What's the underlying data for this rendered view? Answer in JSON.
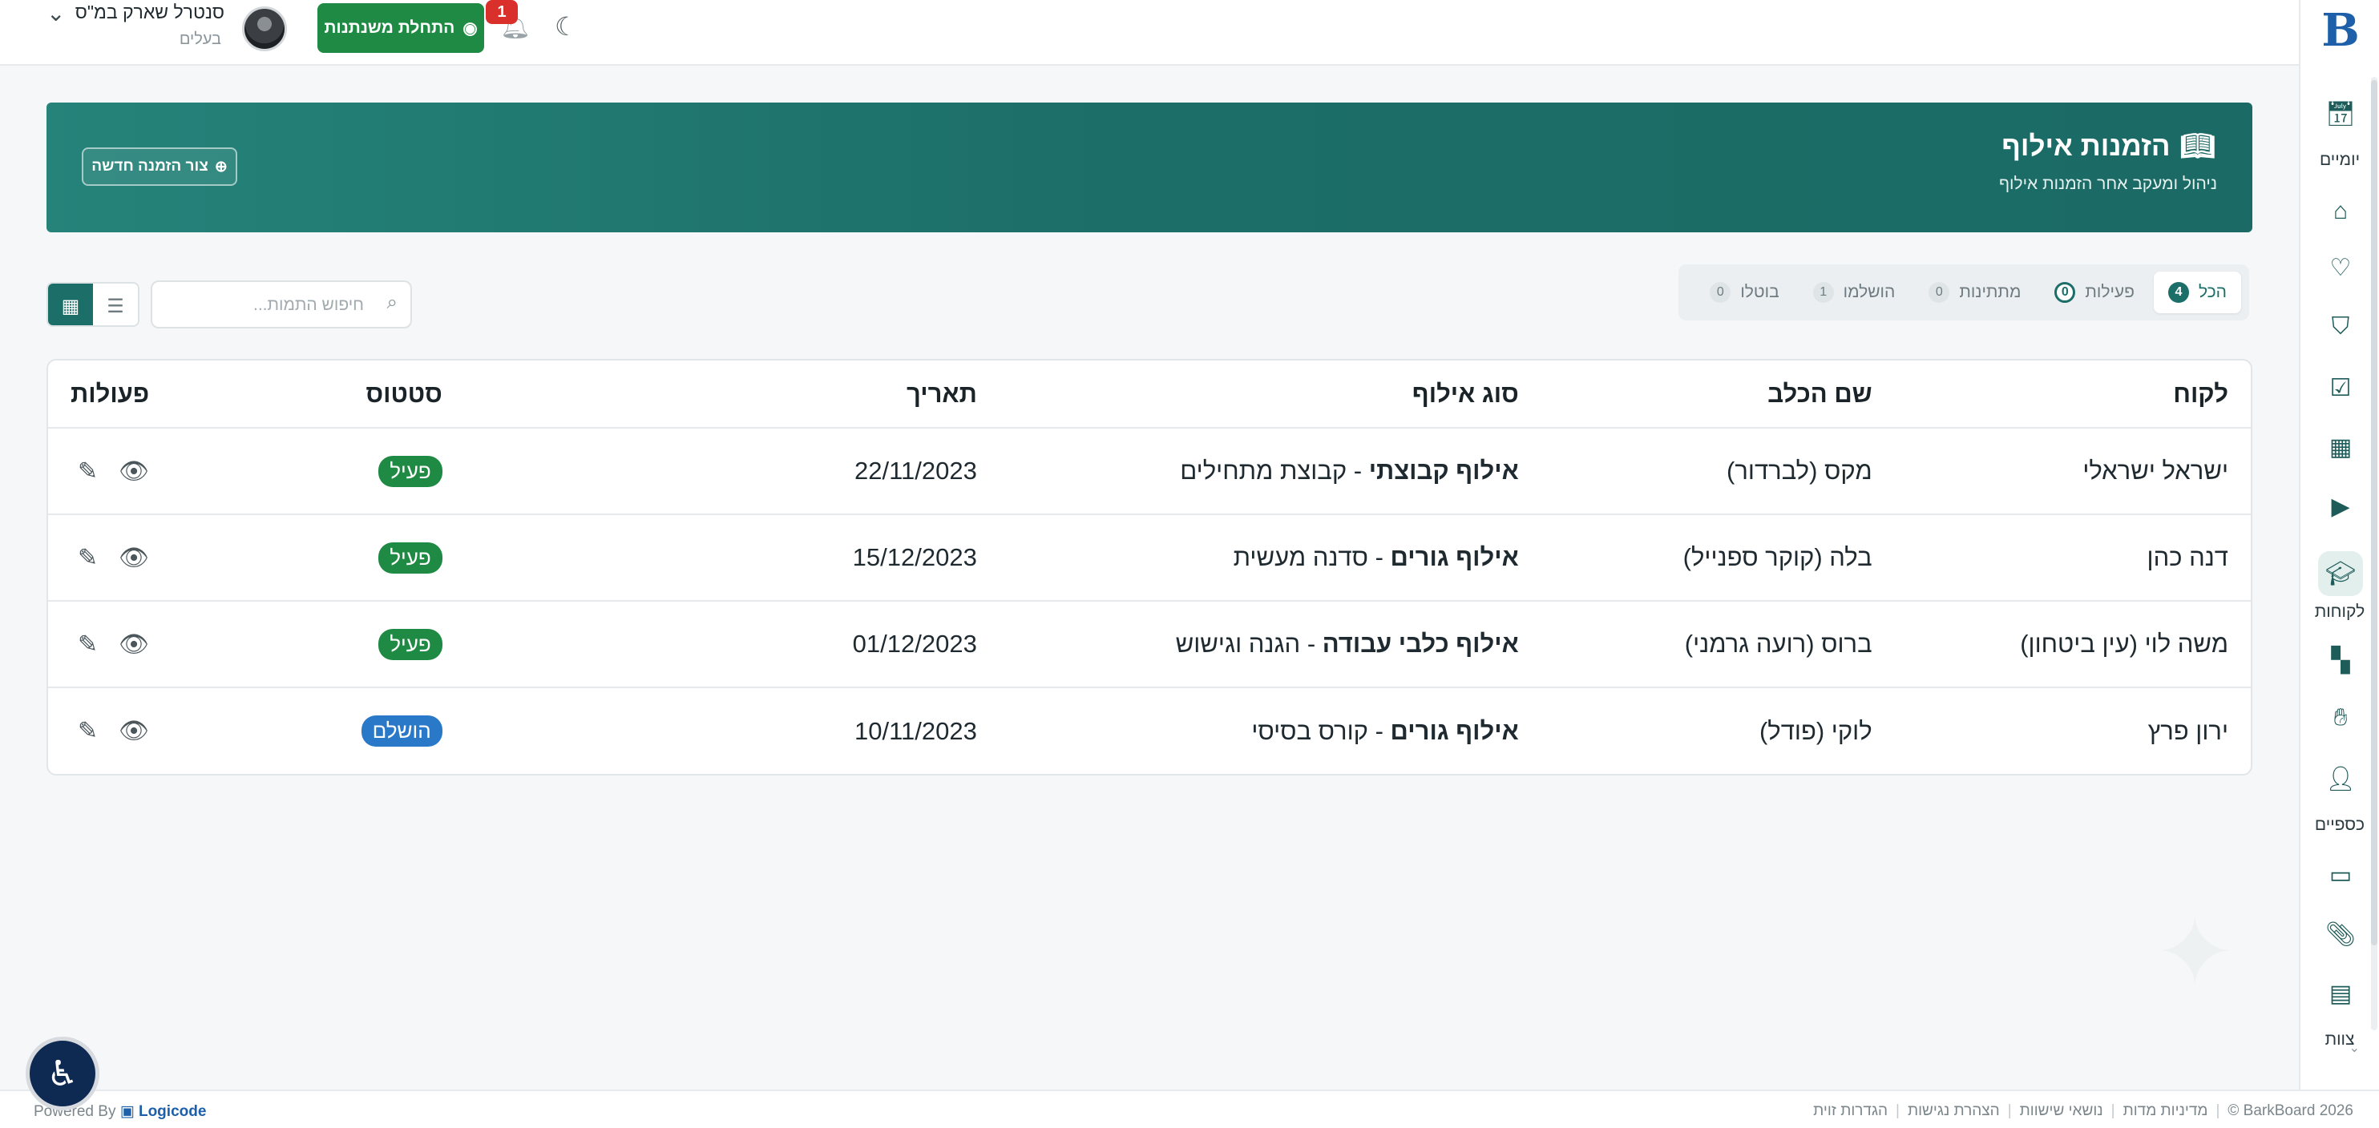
{
  "brand": {
    "logo_letter": "B"
  },
  "topbar": {
    "user_name": "סנטרל שארק במ\"ס",
    "user_role": "בעלים",
    "start_year_label": "התחלת משנתנות",
    "notification_count": "1"
  },
  "sidebar": {
    "items": [
      {
        "icon": "calendar-icon",
        "label": "יומיים"
      },
      {
        "icon": "home-icon",
        "label": ""
      },
      {
        "icon": "heartbeat-icon",
        "label": ""
      },
      {
        "icon": "shield-icon",
        "label": ""
      },
      {
        "icon": "calendar-check-icon",
        "label": ""
      },
      {
        "icon": "grid-calendar-icon",
        "label": ""
      },
      {
        "icon": "video-icon",
        "label": ""
      },
      {
        "icon": "graduation-cap-icon",
        "label": "לקוחות",
        "active": true
      },
      {
        "icon": "apps-icon",
        "label": ""
      },
      {
        "icon": "handshake-icon",
        "label": ""
      },
      {
        "icon": "user-plus-icon",
        "label": "כספיים"
      },
      {
        "icon": "terminal-icon",
        "label": ""
      },
      {
        "icon": "paperclip-icon",
        "label": ""
      },
      {
        "icon": "document-icon",
        "label": "צוות"
      }
    ]
  },
  "banner": {
    "title": "הזמנות אילוף",
    "subtitle": "ניהול ומעקב אחר הזמנות אילוף",
    "new_order_label": "צור הזמנה חדשה"
  },
  "tabs": [
    {
      "label": "הכל",
      "count": "4",
      "active": true
    },
    {
      "label": "פעילות",
      "count": "0"
    },
    {
      "label": "מתתינות",
      "count": "0"
    },
    {
      "label": "הושלמו",
      "count": "1"
    },
    {
      "label": "בוטלו",
      "count": "0"
    }
  ],
  "search": {
    "placeholder": "חיפוש התמות...",
    "value": ""
  },
  "table": {
    "headers": {
      "client": "לקוח",
      "dog": "שם הכלב",
      "type": "סוג אילוף",
      "date": "תאריך",
      "status": "סטטוס",
      "actions": "פעולות"
    },
    "rows": [
      {
        "client": "ישראל ישראלי",
        "dog": "מקס (לברדור)",
        "type_main": "אילוף קבוצתי",
        "type_sep": " - ",
        "type_detail": "קבוצת מתחילים",
        "date": "22/11/2023",
        "status": "פעיל",
        "status_kind": "active"
      },
      {
        "client": "דנה כהן",
        "dog": "בלה (קוקר ספנייל)",
        "type_main": "אילוף גורים",
        "type_sep": " - ",
        "type_detail": "סדנה מעשית",
        "date": "15/12/2023",
        "status": "פעיל",
        "status_kind": "active"
      },
      {
        "client": "משה לוי (עין ביטחון)",
        "dog": "ברוס (רועה גרמני)",
        "type_main": "אילוף כלבי עבודה",
        "type_sep": " - ",
        "type_detail": "הגנה וגישוש",
        "date": "01/12/2023",
        "status": "פעיל",
        "status_kind": "active"
      },
      {
        "client": "ירון פרץ",
        "dog": "לוקי (פודל)",
        "type_main": "אילוף גורים",
        "type_sep": " - ",
        "type_detail": "קורס בסיסי",
        "date": "10/11/2023",
        "status": "הושלם",
        "status_kind": "done"
      }
    ]
  },
  "footer": {
    "copyright": "BarkBoard 2026 ©",
    "links": [
      "מדיניות מדות",
      "נושאי שישוות",
      "הצהרת נגישות",
      "הגדרות זוית"
    ],
    "powered_by": "Powered By",
    "powered_brand": "Logicode"
  },
  "colors": {
    "accent": "#1c6e68",
    "success": "#1f8a43",
    "info": "#2a79c8",
    "danger": "#d9302b"
  }
}
